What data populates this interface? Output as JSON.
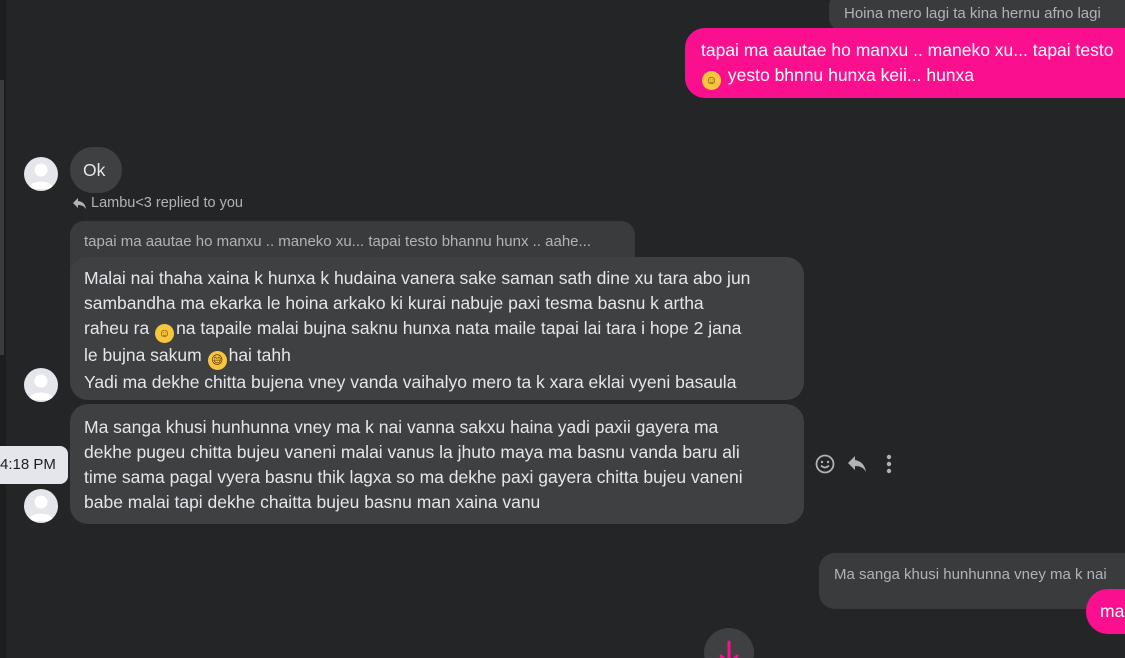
{
  "messages": {
    "top_out_quote": "Hoina mero lagi ta kina hernu afno lagi",
    "out_msg1": {
      "line1": "tapai ma aautae ho manxu .. maneko xu... tapai testo",
      "line2_emoji": "☺",
      "line2": "yesto bhnnu hunxa keii... hunxa"
    },
    "ok": "Ok",
    "reply_note": "Lambu<3 replied to you",
    "reply_quote": "tapai ma aautae ho manxu .. maneko xu... tapai testo bhannu hunx .. aahe...",
    "long_msg": {
      "line1": "Malai nai thaha xaina k hunxa k hudaina vanera sake saman sath dine xu tara abo jun",
      "line2": "sambandha ma ekarka le hoina arkako ki kurai nabuje paxi tesma basnu k artha",
      "line3a": "raheu ra",
      "emoji1": "☺",
      "line3b": "na tapaile malai bujna saknu hunxa nata maile tapai lai tara i hope 2 jana",
      "line4a": "le bujna sakum",
      "emoji2": "😅",
      "line4b": "hai tahh",
      "line5": "Yadi ma dekhe chitta bujena vney vanda vaihalyo mero ta k xara eklai vyeni basaula"
    },
    "sanga_msg": {
      "line1": "Ma sanga khusi hunhunna vney ma k nai vanna sakxu haina yadi paxii gayera ma",
      "line2": "dekhe pugeu chitta bujeu vaneni malai vanus la jhuto maya ma basnu vanda baru ali",
      "line3": "time sama pagal vyera basnu thik lagxa so ma dekhe paxi gayera chitta bujeu vaneni",
      "line4": "babe malai tapi dekhe chaitta bujeu basnu man xaina vanu"
    },
    "time_tip": "4:18 PM",
    "bottom_out_quote": "Ma sanga khusi hunhunna vney ma k nai",
    "bottom_out_partial": "ma"
  },
  "icons": {
    "react": "smiley-icon",
    "reply": "reply-arrow-icon",
    "more": "more-vertical-icon",
    "scroll": "arrow-down-icon"
  },
  "colors": {
    "background": "#242526",
    "incoming_bubble": "#3e4042",
    "outgoing_bubble": "#fa0f8e",
    "quote_bubble": "#3a3b3c",
    "accent": "#fa0f8e"
  }
}
